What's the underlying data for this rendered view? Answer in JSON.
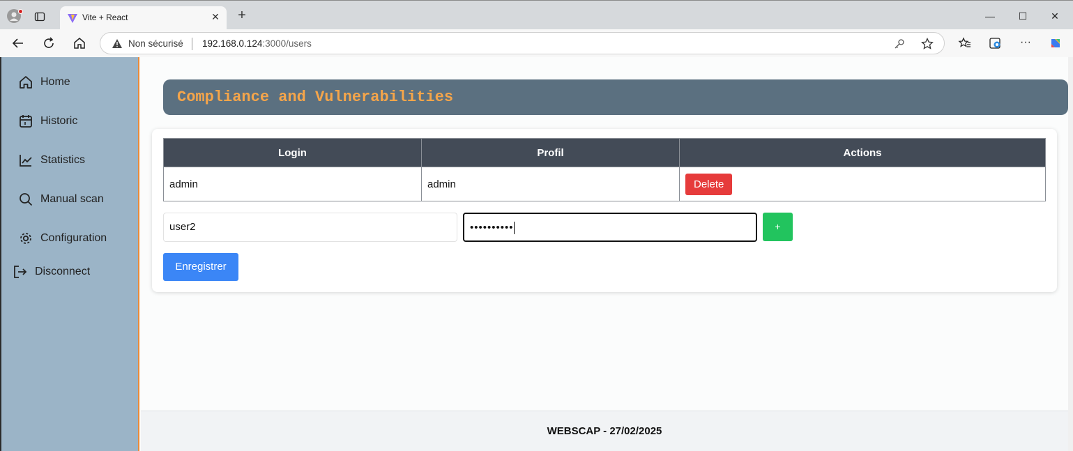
{
  "browser": {
    "tab_title": "Vite + React",
    "security_label": "Non sécurisé",
    "url_host": "192.168.0.124",
    "url_rest": ":3000/users"
  },
  "sidebar": {
    "items": [
      {
        "label": "Home",
        "icon": "home-icon"
      },
      {
        "label": "Historic",
        "icon": "calendar-icon"
      },
      {
        "label": "Statistics",
        "icon": "chart-icon"
      },
      {
        "label": "Manual scan",
        "icon": "search-icon"
      },
      {
        "label": "Configuration",
        "icon": "gear-icon"
      },
      {
        "label": "Disconnect",
        "icon": "logout-icon"
      }
    ]
  },
  "header": {
    "title": "Compliance and Vulnerabilities"
  },
  "users_table": {
    "headers": [
      "Login",
      "Profil",
      "Actions"
    ],
    "rows": [
      {
        "login": "admin",
        "profil": "admin",
        "action": "Delete"
      }
    ]
  },
  "form": {
    "login_value": "user2",
    "password_mask": "••••••••••",
    "add_label": "+",
    "save_label": "Enregistrer"
  },
  "footer": {
    "text": "WEBSCAP - 27/02/2025"
  },
  "colors": {
    "sidebar": "#9bb4c7",
    "header_bar": "#5b7080",
    "header_title": "#f5a54a",
    "delete": "#e63b3b",
    "add": "#22c45e",
    "save": "#3b86f6"
  }
}
